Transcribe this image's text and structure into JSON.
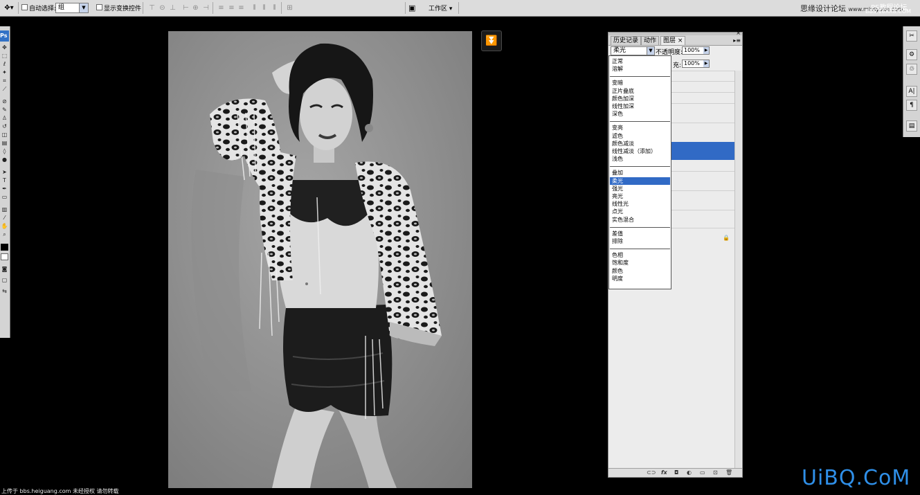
{
  "options_bar": {
    "auto_select_label": "自动选择:",
    "auto_select_value": "组",
    "show_transform_label": "显示变换控件",
    "workspace_label": "工作区",
    "brand_text": "思缘设计论坛",
    "brand_site": "www.missyuan.com",
    "brand_icon_text": "PS教程论坛",
    "brand_icon_site": "BBS.16XX8.COM"
  },
  "toolbox": {
    "logo": "Ps"
  },
  "layers_panel": {
    "tabs": [
      "历史记录",
      "动作",
      "图层"
    ],
    "active_tab": "图层",
    "blend_mode": "柔光",
    "opacity_label": "不透明度:",
    "opacity_value": "100%",
    "fill_label": "充:",
    "fill_value": "100%"
  },
  "blend_dropdown": {
    "groups": [
      [
        "正常",
        "溶解"
      ],
      [
        "变暗",
        "正片叠底",
        "颜色加深",
        "线性加深",
        "深色"
      ],
      [
        "变亮",
        "滤色",
        "颜色减淡",
        "线性减淡（添加）",
        "浅色"
      ],
      [
        "叠加",
        "柔光",
        "强光",
        "亮光",
        "线性光",
        "点光",
        "实色混合"
      ],
      [
        "差值",
        "排除"
      ],
      [
        "色相",
        "饱和度",
        "颜色",
        "明度"
      ]
    ],
    "selected": "柔光"
  },
  "status_text": "上传于 bbs.heiguang.com 未经授权 请勿转载",
  "watermark": "UiBQ.CoM",
  "colors": {
    "accent_blue": "#316ac5",
    "watermark": "#2f8fe8"
  }
}
